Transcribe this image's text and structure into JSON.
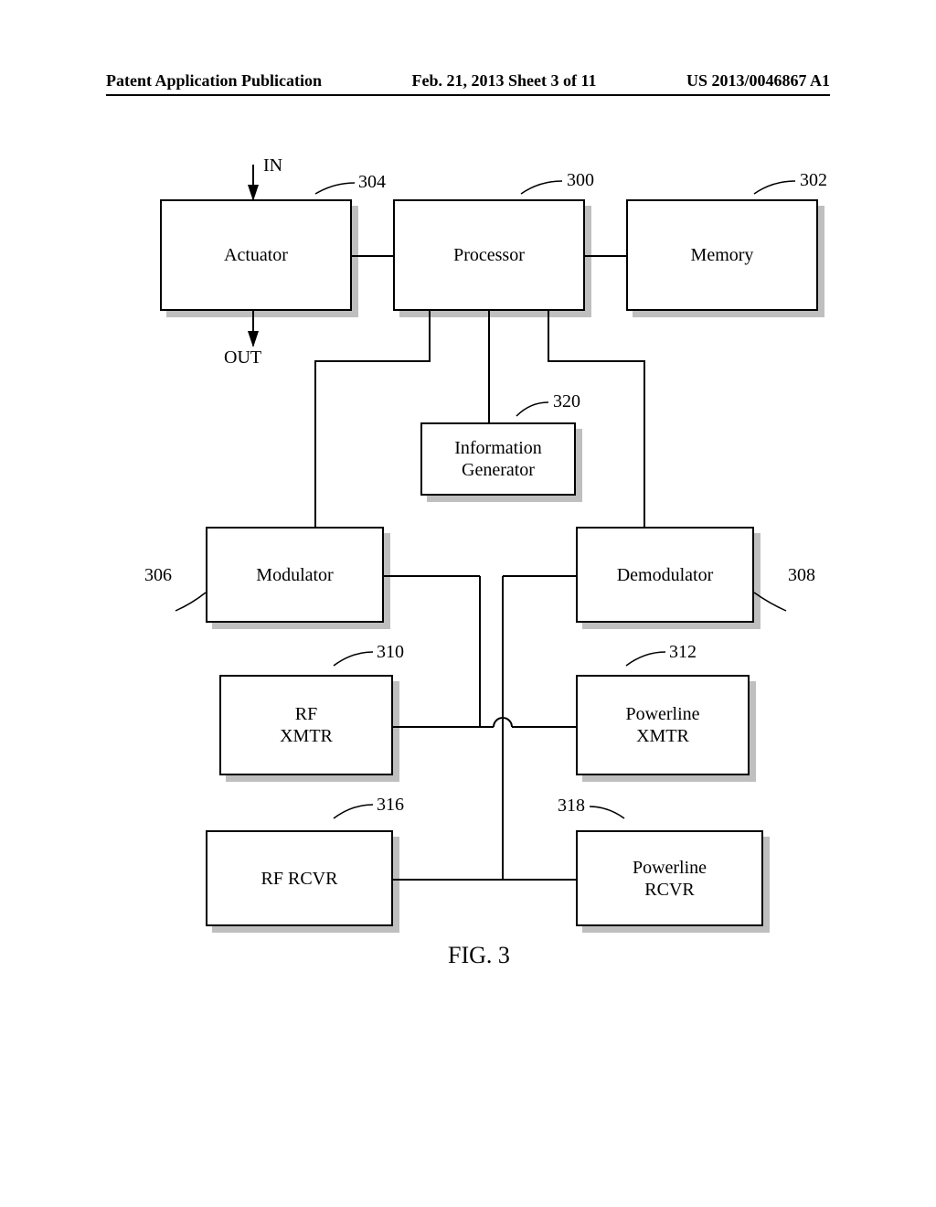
{
  "header": {
    "left": "Patent Application Publication",
    "center": "Feb. 21, 2013  Sheet 3 of 11",
    "right": "US 2013/0046867 A1"
  },
  "labels": {
    "in": "IN",
    "out": "OUT"
  },
  "refs": {
    "actuator": "304",
    "processor": "300",
    "memory": "302",
    "infogen": "320",
    "modulator": "306",
    "demodulator": "308",
    "rfxmtr": "310",
    "plxmtr": "312",
    "rfrcvr": "316",
    "plrcvr": "318"
  },
  "boxes": {
    "actuator": "Actuator",
    "processor": "Processor",
    "memory": "Memory",
    "infogen_l1": "Information",
    "infogen_l2": "Generator",
    "modulator": "Modulator",
    "demodulator": "Demodulator",
    "rfxmtr_l1": "RF",
    "rfxmtr_l2": "XMTR",
    "plxmtr_l1": "Powerline",
    "plxmtr_l2": "XMTR",
    "rfrcvr": "RF RCVR",
    "plrcvr_l1": "Powerline",
    "plrcvr_l2": "RCVR"
  },
  "caption": "FIG. 3"
}
